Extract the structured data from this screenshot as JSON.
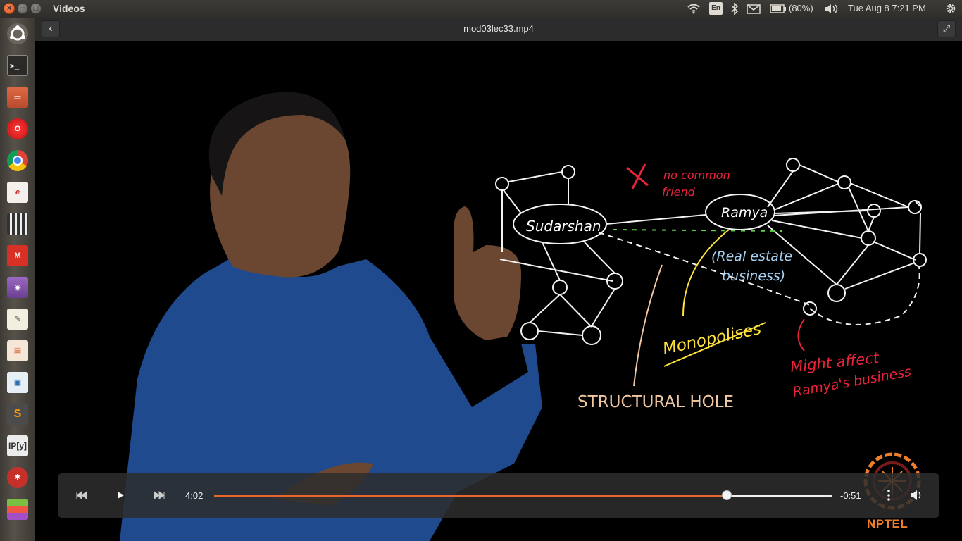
{
  "top_panel": {
    "app_title": "Videos",
    "keyboard_layout": "En",
    "battery": "(80%)",
    "datetime": "Tue Aug  8  7:21 PM"
  },
  "header": {
    "file_title": "mod03lec33.mp4"
  },
  "launcher": {
    "items": [
      "dash-home",
      "terminal",
      "files",
      "opera",
      "chrome",
      "text-editor",
      "video-editor",
      "gmail",
      "webcam",
      "notes",
      "presentation",
      "image-viewer",
      "sublime-text",
      "ipython",
      "network-tool",
      "misc-app"
    ]
  },
  "video": {
    "annotations": {
      "node_left": "Sudarshan",
      "node_right": "Ramya",
      "no_common_1": "no common",
      "no_common_2": "friend",
      "real_estate_1": "(Real estate",
      "real_estate_2": "business)",
      "monopolises": "Monopolises",
      "structural_hole": "STRUCTURAL HOLE",
      "might_affect_1": "Might affect",
      "might_affect_2": "Ramya's business"
    },
    "watermark": "NPTEL"
  },
  "controls": {
    "elapsed": "4:02",
    "remaining": "-0:51",
    "progress": 0.83,
    "accent_color": "#e9652c"
  }
}
